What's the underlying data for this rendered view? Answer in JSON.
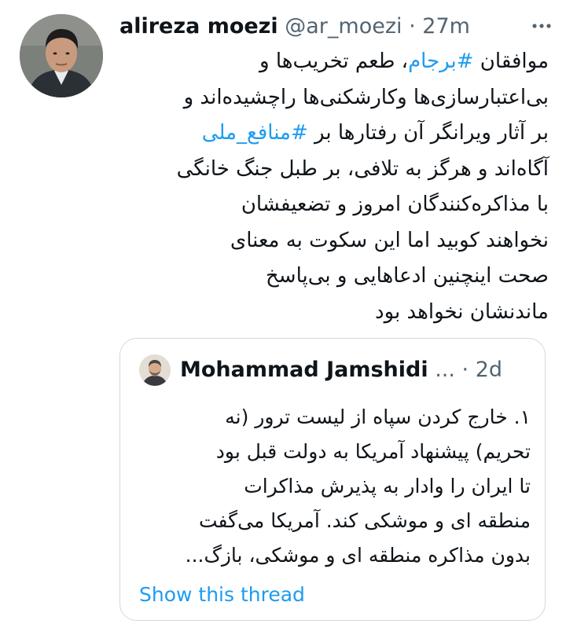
{
  "tweet": {
    "author_name": "alireza moezi",
    "handle": "@ar_moezi",
    "separator": "·",
    "time": "27m",
    "avatar_icon": "profile-photo",
    "more_icon": "more-options-icon",
    "body_lines": [
      {
        "before": "موافقان ",
        "tag": "#برجام",
        "after": "، طعم تخریب‌ها و"
      },
      {
        "text": "بی‌اعتبارسازی‌ها وکارشکنی‌ها راچشیده‌اند و"
      },
      {
        "before": "بر آثار ویرانگر آن رفتارها بر ",
        "tag": "#منافع_ملی",
        "after": ""
      },
      {
        "text": "آگاه‌اند و هرگز به تلافی، بر طبل جنگ خانگی"
      },
      {
        "text": "با مذاکره‌کنندگان امروز و تضعیفشان"
      },
      {
        "text": "نخواهند کوبید اما این سکوت به معنای"
      },
      {
        "text": "صحت اینچنین ادعاهایی و بی‌پاسخ"
      },
      {
        "text": "ماندنشان نخواهد بود"
      }
    ]
  },
  "quote": {
    "author_name": "Mohammad Jamshidi",
    "ellipsis": "...",
    "separator": "·",
    "time": "2d",
    "avatar_icon": "profile-photo",
    "text_lines": [
      "۱. خارج کردن سپاه از لیست ترور (نه",
      "تحریم) پیشنهاد آمریکا به دولت قبل بود",
      "تا ایران را وادار به پذیرش مذاکرات",
      "منطقه ای و موشکی کند. آمریکا می‌گفت",
      "بدون مذاکره منطقه ای و موشکی، بازگ..."
    ],
    "show_thread": "Show this thread"
  },
  "colors": {
    "link": "#1d9bf0",
    "secondary_text": "#536471",
    "border": "#cfd9de",
    "primary_text": "#0f1419"
  }
}
